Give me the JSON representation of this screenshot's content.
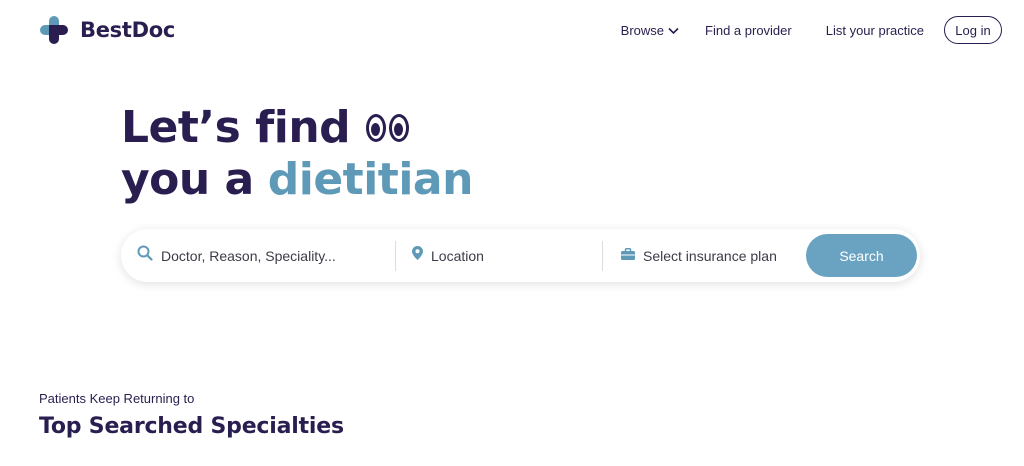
{
  "brand": {
    "name": "BestDoc",
    "logo_icon": "medical-cross-logo"
  },
  "nav": {
    "browse": "Browse",
    "find_provider": "Find a provider",
    "list_practice": "List your practice",
    "login": "Log in"
  },
  "hero": {
    "line1": "Let’s find",
    "line2_prefix": "you a",
    "line2_accent": "dietitian"
  },
  "search": {
    "query_placeholder": "Doctor, Reason, Speciality...",
    "location_placeholder": "Location",
    "insurance_label": "Select insurance plan",
    "button_label": "Search"
  },
  "specialties": {
    "kicker": "Patients Keep Returning to",
    "title": "Top Searched Specialties"
  },
  "colors": {
    "primary": "#2a1d4f",
    "accent": "#5e9ab8",
    "button": "#6aa3c2",
    "logo_dark": "#2a1d4f",
    "logo_light": "#5e9ab8"
  }
}
